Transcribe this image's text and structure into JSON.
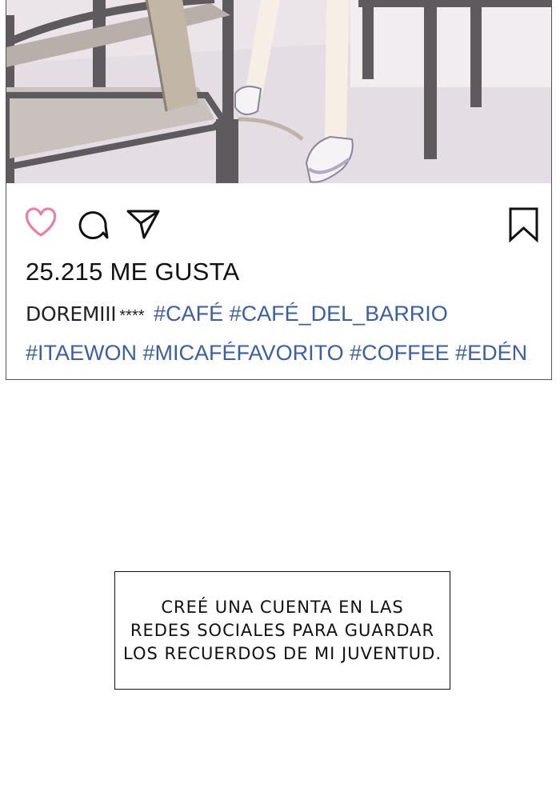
{
  "post": {
    "image_description_icon": "photo-chair-legs",
    "likes_text": "25.215 ME GUSTA",
    "caption": {
      "username": "DOREMIII",
      "stars": "****",
      "hashtags_line1": [
        "#CAFÉ",
        "#CAFÉ_DEL_BARRIO"
      ],
      "hashtags_line2": [
        "#ITAEWON",
        "#MICAFÉFAVORITO",
        "#COFFEE",
        "#EDÉN"
      ]
    },
    "icons": {
      "like": "heart-icon",
      "comment": "comment-bubble-icon",
      "share": "send-icon",
      "bookmark": "bookmark-icon"
    },
    "colors": {
      "like": "#f07aa6",
      "hashtag": "#3a5ea8",
      "border": "#555555"
    }
  },
  "narration": {
    "line1": "CREÉ UNA CUENTA EN LAS",
    "line2": "REDES SOCIALES PARA GUARDAR",
    "line3": "LOS RECUERDOS DE MI JUVENTUD."
  }
}
